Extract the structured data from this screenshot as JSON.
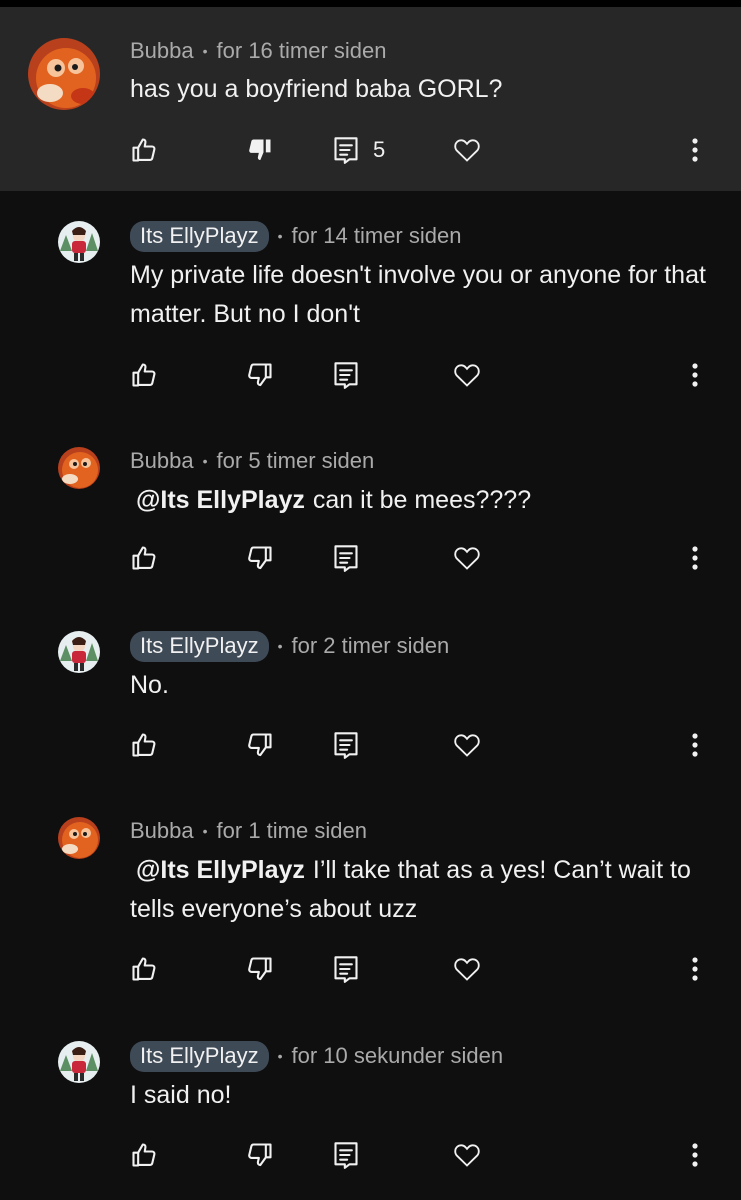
{
  "comments": [
    {
      "author": "Bubba",
      "time": "for 16 timer siden",
      "text": "has you a boyfriend baba GORL?",
      "mention": "",
      "replies": "5",
      "is_creator": false
    },
    {
      "author": "Its EllyPlayz",
      "time": "for 14 timer siden",
      "text": "My private life doesn't involve you or anyone for that matter. But no I don't",
      "mention": "",
      "is_creator": true
    },
    {
      "author": "Bubba",
      "time": "for 5 timer siden",
      "text": "can it be mees????",
      "mention": "@Its EllyPlayz",
      "is_creator": false
    },
    {
      "author": "Its EllyPlayz",
      "time": "for 2 timer siden",
      "text": "No.",
      "mention": "",
      "is_creator": true
    },
    {
      "author": "Bubba",
      "time": "for 1 time siden",
      "text": "I’ll take that as a yes! Can’t wait to tells everyone’s about uzz",
      "mention": "@Its EllyPlayz",
      "is_creator": false
    },
    {
      "author": "Its EllyPlayz",
      "time": "for 10 sekunder siden",
      "text": "I said no!",
      "mention": "",
      "is_creator": true
    }
  ],
  "colors": {
    "background": "#0f0f0f",
    "highlight": "#272727",
    "chip": "#3f4a57",
    "meta": "#aaaaaa",
    "text": "#f1f1f1"
  },
  "icons": [
    "thumbs-up-icon",
    "thumbs-down-icon",
    "reply-icon",
    "heart-icon",
    "more-vert-icon"
  ]
}
